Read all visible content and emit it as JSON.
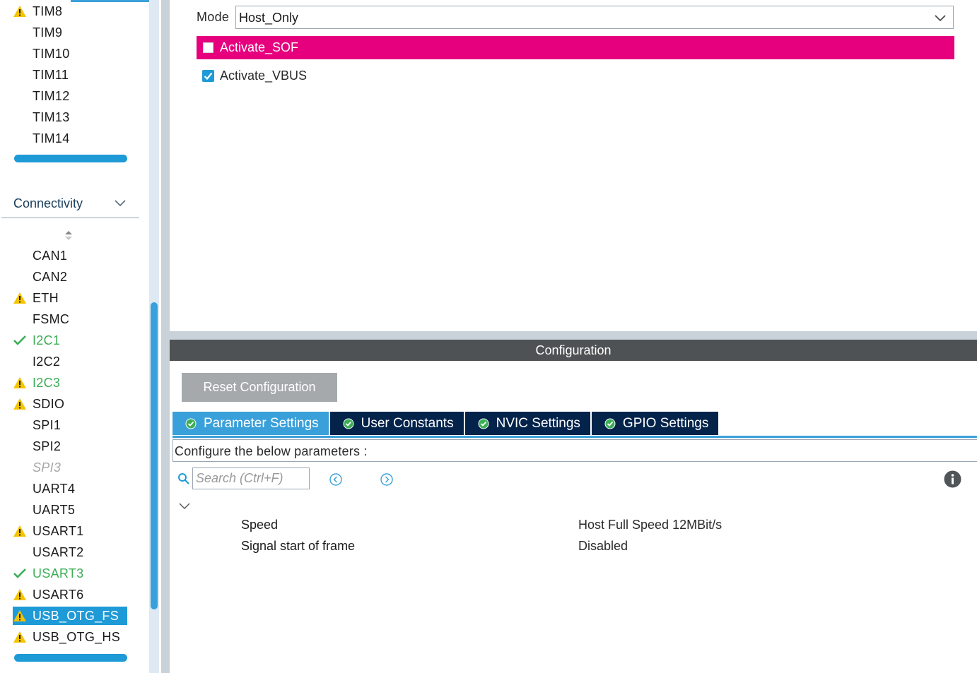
{
  "sidebar": {
    "timers": [
      {
        "label": "TIM8",
        "status": "warning"
      },
      {
        "label": "TIM9",
        "status": "none"
      },
      {
        "label": "TIM10",
        "status": "none"
      },
      {
        "label": "TIM11",
        "status": "none"
      },
      {
        "label": "TIM12",
        "status": "none"
      },
      {
        "label": "TIM13",
        "status": "none"
      },
      {
        "label": "TIM14",
        "status": "none"
      }
    ],
    "connectivity": {
      "title": "Connectivity",
      "items": [
        {
          "label": "CAN1",
          "status": "none"
        },
        {
          "label": "CAN2",
          "status": "none"
        },
        {
          "label": "ETH",
          "status": "warning"
        },
        {
          "label": "FSMC",
          "status": "none"
        },
        {
          "label": "I2C1",
          "status": "ok"
        },
        {
          "label": "I2C2",
          "status": "none"
        },
        {
          "label": "I2C3",
          "status": "warning-green"
        },
        {
          "label": "SDIO",
          "status": "warning"
        },
        {
          "label": "SPI1",
          "status": "none"
        },
        {
          "label": "SPI2",
          "status": "none"
        },
        {
          "label": "SPI3",
          "status": "disabled"
        },
        {
          "label": "UART4",
          "status": "none"
        },
        {
          "label": "UART5",
          "status": "none"
        },
        {
          "label": "USART1",
          "status": "warning"
        },
        {
          "label": "USART2",
          "status": "none"
        },
        {
          "label": "USART3",
          "status": "ok"
        },
        {
          "label": "USART6",
          "status": "warning"
        },
        {
          "label": "USB_OTG_FS",
          "status": "warning-selected"
        },
        {
          "label": "USB_OTG_HS",
          "status": "warning"
        }
      ]
    }
  },
  "mode": {
    "label": "Mode",
    "value": "Host_Only",
    "activate_sof": {
      "label": "Activate_SOF",
      "checked": false
    },
    "activate_vbus": {
      "label": "Activate_VBUS",
      "checked": true
    }
  },
  "configuration": {
    "title": "Configuration",
    "reset_label": "Reset Configuration",
    "tabs": [
      {
        "label": "Parameter Settings",
        "active": true
      },
      {
        "label": "User Constants",
        "active": false
      },
      {
        "label": "NVIC Settings",
        "active": false
      },
      {
        "label": "GPIO Settings",
        "active": false
      }
    ],
    "params_title": "Configure the below parameters :",
    "search_placeholder": "Search (Ctrl+F)",
    "parameters": [
      {
        "name": "Speed",
        "value": "Host Full Speed 12MBit/s"
      },
      {
        "name": "Signal start of frame",
        "value": "Disabled"
      }
    ]
  },
  "colors": {
    "accent": "#1e9ad6",
    "highlight": "#e6007e",
    "tab_dark": "#03234b",
    "header_gray": "#4f5254",
    "warning": "#f5c400",
    "ok_green": "#3cae55"
  }
}
